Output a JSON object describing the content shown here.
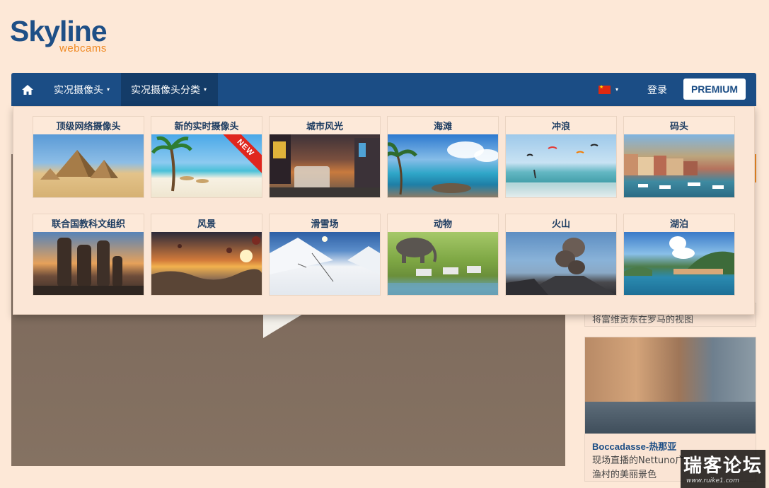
{
  "logo": {
    "main": "Skyline",
    "sub": "webcams"
  },
  "navbar": {
    "home_icon": "home-icon",
    "items": [
      {
        "label": "实况摄像头",
        "caret": "▾",
        "active": false
      },
      {
        "label": "实况摄像头分类",
        "caret": "▾",
        "active": true
      }
    ],
    "language_caret": "▾",
    "login_label": "登录",
    "premium_label": "PREMIUM"
  },
  "dropdown": {
    "categories": [
      {
        "label": "顶级网络摄像头",
        "image": "pyramids"
      },
      {
        "label": "新的实时摄像头",
        "image": "beach",
        "badge": "NEW"
      },
      {
        "label": "城市风光",
        "image": "city"
      },
      {
        "label": "海滩",
        "image": "seaside"
      },
      {
        "label": "冲浪",
        "image": "surf"
      },
      {
        "label": "码头",
        "image": "port"
      },
      {
        "label": "联合国教科文组织",
        "image": "moai"
      },
      {
        "label": "风景",
        "image": "scenery"
      },
      {
        "label": "滑雪场",
        "image": "ski"
      },
      {
        "label": "动物",
        "image": "animals"
      },
      {
        "label": "火山",
        "image": "volcano"
      },
      {
        "label": "湖泊",
        "image": "lake"
      }
    ]
  },
  "sidebar": {
    "card1_text": "将富维贡东在罗马的视图",
    "card2": {
      "title": "Boccadasse-热那亚",
      "desc_line1": "现场直播的Nettuno广",
      "desc_line2": "渔村的美丽景色"
    }
  },
  "watermark": {
    "big": "瑞客论坛",
    "small": "www.ruike1.com"
  },
  "colors": {
    "navbar": "#1b4d85",
    "navbar_active": "#143c68",
    "page_bg": "#fde8d7",
    "accent_orange": "#f08a24",
    "logo_blue": "#1e4f86"
  }
}
